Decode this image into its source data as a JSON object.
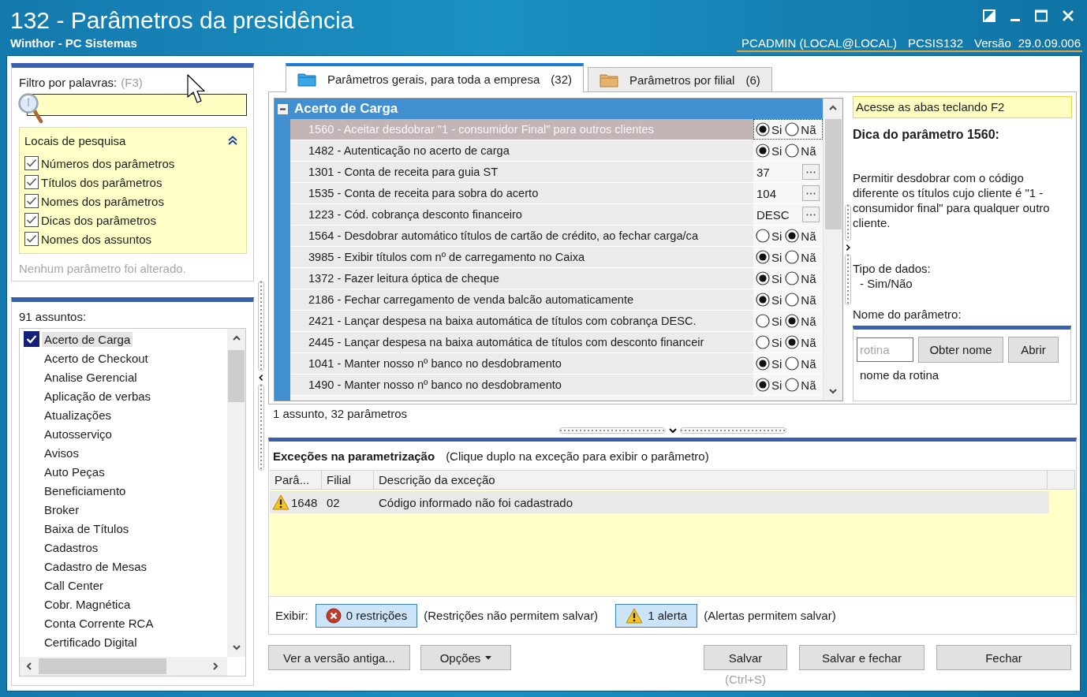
{
  "window": {
    "title": "132 - Parâmetros da presidência",
    "subtitle": "Winthor - PC Sistemas",
    "user": "PCADMIN (LOCAL@LOCAL)",
    "program": "PCSIS132",
    "version_label": "Versão",
    "version": "29.0.09.006"
  },
  "filter": {
    "label": "Filtro por palavras:",
    "shortcut": "(F3)"
  },
  "search_locations": {
    "title": "Locais de pesquisa",
    "expanded": true,
    "options": [
      {
        "label": "Números dos parâmetros",
        "checked": true
      },
      {
        "label": "Títulos dos parâmetros",
        "checked": true
      },
      {
        "label": "Nomes dos parâmetros",
        "checked": true
      },
      {
        "label": "Dicas dos parâmetros",
        "checked": true
      },
      {
        "label": "Nomes dos assuntos",
        "checked": true
      }
    ]
  },
  "status_message": "Nenhum parâmetro foi alterado.",
  "subjects": {
    "count_label": "91 assuntos:",
    "items": [
      {
        "label": "Acerto de Carga",
        "checked": true,
        "selected": true
      },
      {
        "label": "Acerto de Checkout",
        "checked": false,
        "selected": false
      },
      {
        "label": "Analise Gerencial",
        "checked": false,
        "selected": false
      },
      {
        "label": "Aplicação de verbas",
        "checked": false,
        "selected": false
      },
      {
        "label": "Atualizações",
        "checked": false,
        "selected": false
      },
      {
        "label": "Autosserviço",
        "checked": false,
        "selected": false
      },
      {
        "label": "Avisos",
        "checked": false,
        "selected": false
      },
      {
        "label": "Auto Peças",
        "checked": false,
        "selected": false
      },
      {
        "label": "Beneficiamento",
        "checked": false,
        "selected": false
      },
      {
        "label": "Broker",
        "checked": false,
        "selected": false
      },
      {
        "label": "Baixa de Títulos",
        "checked": false,
        "selected": false
      },
      {
        "label": "Cadastros",
        "checked": false,
        "selected": false
      },
      {
        "label": "Cadastro de Mesas",
        "checked": false,
        "selected": false
      },
      {
        "label": "Call Center",
        "checked": false,
        "selected": false
      },
      {
        "label": "Cobr. Magnética",
        "checked": false,
        "selected": false
      },
      {
        "label": "Conta Corrente RCA",
        "checked": false,
        "selected": false
      },
      {
        "label": "Certificado Digital",
        "checked": false,
        "selected": false
      }
    ]
  },
  "tabs": [
    {
      "label": "Parâmetros gerais, para toda a empresa",
      "count": "(32)",
      "selected": true
    },
    {
      "label": "Parâmetros por filial",
      "count": "(6)",
      "selected": false
    }
  ],
  "parameters": {
    "group": {
      "title": "Acerto de Carga",
      "expanded": true
    },
    "rows": [
      {
        "label": "1560 - Aceitar desdobrar \"1 - consumidor Final\" para outros clientes",
        "selected": true,
        "kind": "yes_no",
        "options": [
          {
            "label": "Si",
            "selected": true
          },
          {
            "label": "Nã",
            "selected": false
          }
        ]
      },
      {
        "label": "1482 - Autenticação no acerto de carga",
        "selected": false,
        "kind": "yes_no",
        "options": [
          {
            "label": "Si",
            "selected": true
          },
          {
            "label": "Nã",
            "selected": false
          }
        ]
      },
      {
        "label": "1301 - Conta de receita para guia ST",
        "selected": false,
        "kind": "lookup",
        "value": "37"
      },
      {
        "label": "1535 - Conta de receita para sobra do acerto",
        "selected": false,
        "kind": "lookup",
        "value": "104"
      },
      {
        "label": "1223 - Cód. cobrança desconto financeiro",
        "selected": false,
        "kind": "lookup",
        "value": "DESC"
      },
      {
        "label": "1564 - Desdobrar automático títulos de cartão de crédito, ao fechar carga/ca",
        "selected": false,
        "kind": "yes_no",
        "options": [
          {
            "label": "Si",
            "selected": false
          },
          {
            "label": "Nã",
            "selected": true
          }
        ]
      },
      {
        "label": "3985 - Exibir títulos com nº de carregamento no Caixa",
        "selected": false,
        "kind": "yes_no",
        "options": [
          {
            "label": "Si",
            "selected": true
          },
          {
            "label": "Nã",
            "selected": false
          }
        ]
      },
      {
        "label": "1372 - Fazer leitura óptica de cheque",
        "selected": false,
        "kind": "yes_no",
        "options": [
          {
            "label": "Si",
            "selected": true
          },
          {
            "label": "Nã",
            "selected": false
          }
        ]
      },
      {
        "label": "2186 - Fechar carregamento de venda balcão automaticamente",
        "selected": false,
        "kind": "yes_no",
        "options": [
          {
            "label": "Si",
            "selected": true
          },
          {
            "label": "Nã",
            "selected": false
          }
        ]
      },
      {
        "label": "2421 - Lançar despesa na baixa automática de títulos com cobrança DESC.",
        "selected": false,
        "kind": "yes_no",
        "options": [
          {
            "label": "Si",
            "selected": false
          },
          {
            "label": "Nã",
            "selected": true
          }
        ]
      },
      {
        "label": "2445 - Lançar despesa na baixa automática de títulos com desconto financeir",
        "selected": false,
        "kind": "yes_no",
        "options": [
          {
            "label": "Si",
            "selected": false
          },
          {
            "label": "Nã",
            "selected": true
          }
        ]
      },
      {
        "label": "1041 - Manter nosso nº banco no desdobramento",
        "selected": false,
        "kind": "yes_no",
        "options": [
          {
            "label": "Si",
            "selected": true
          },
          {
            "label": "Nã",
            "selected": false
          }
        ]
      },
      {
        "label": "1490 - Manter nosso nº banco no desdobramento",
        "selected": false,
        "kind": "yes_no",
        "options": [
          {
            "label": "Si",
            "selected": true
          },
          {
            "label": "Nã",
            "selected": false
          }
        ]
      }
    ]
  },
  "summary": "1 assunto, 32 parâmetros",
  "hint": {
    "access_tip": "Acesse as abas teclando F2",
    "title": "Dica do parâmetro 1560:",
    "text": "Permitir desdobrar com o código diferente os títulos cujo cliente é \"1 - consumidor final\" para qualquer outro cliente.",
    "data_type_label": "Tipo de dados:",
    "data_type": "- Sim/Não",
    "name_label": "Nome do parâmetro:",
    "routine_placeholder": "rotina",
    "buttons": [
      "Obter nome",
      "Abrir"
    ],
    "routine_name": "nome da rotina"
  },
  "exceptions": {
    "title": "Exceções na parametrização",
    "note": "(Clique duplo na exceção para exibir o parâmetro)",
    "columns": [
      "Parâ...",
      "Filial",
      "Descrição da exceção"
    ],
    "rows": [
      {
        "kind": "alert",
        "selected": true,
        "cells": [
          "1648",
          "02",
          "Código informado não foi cadastrado"
        ]
      }
    ],
    "show_label": "Exibir:",
    "filters": [
      {
        "kind": "restriction",
        "label": "0 restrições",
        "selected": true,
        "note": "(Restrições não permitem salvar)"
      },
      {
        "kind": "alert",
        "label": "1 alerta",
        "selected": true,
        "note": "(Alertas permitem salvar)"
      }
    ]
  },
  "footer": {
    "left_buttons": [
      {
        "label": "Ver a versão antiga...",
        "kind": "plain"
      },
      {
        "label": "Opções",
        "kind": "dropdown"
      }
    ],
    "right_buttons": [
      {
        "label": "Salvar",
        "kind": "plain",
        "shortcut": "(Ctrl+S)"
      },
      {
        "label": "Salvar e fechar",
        "kind": "plain"
      },
      {
        "label": "Fechar",
        "kind": "plain"
      }
    ]
  }
}
